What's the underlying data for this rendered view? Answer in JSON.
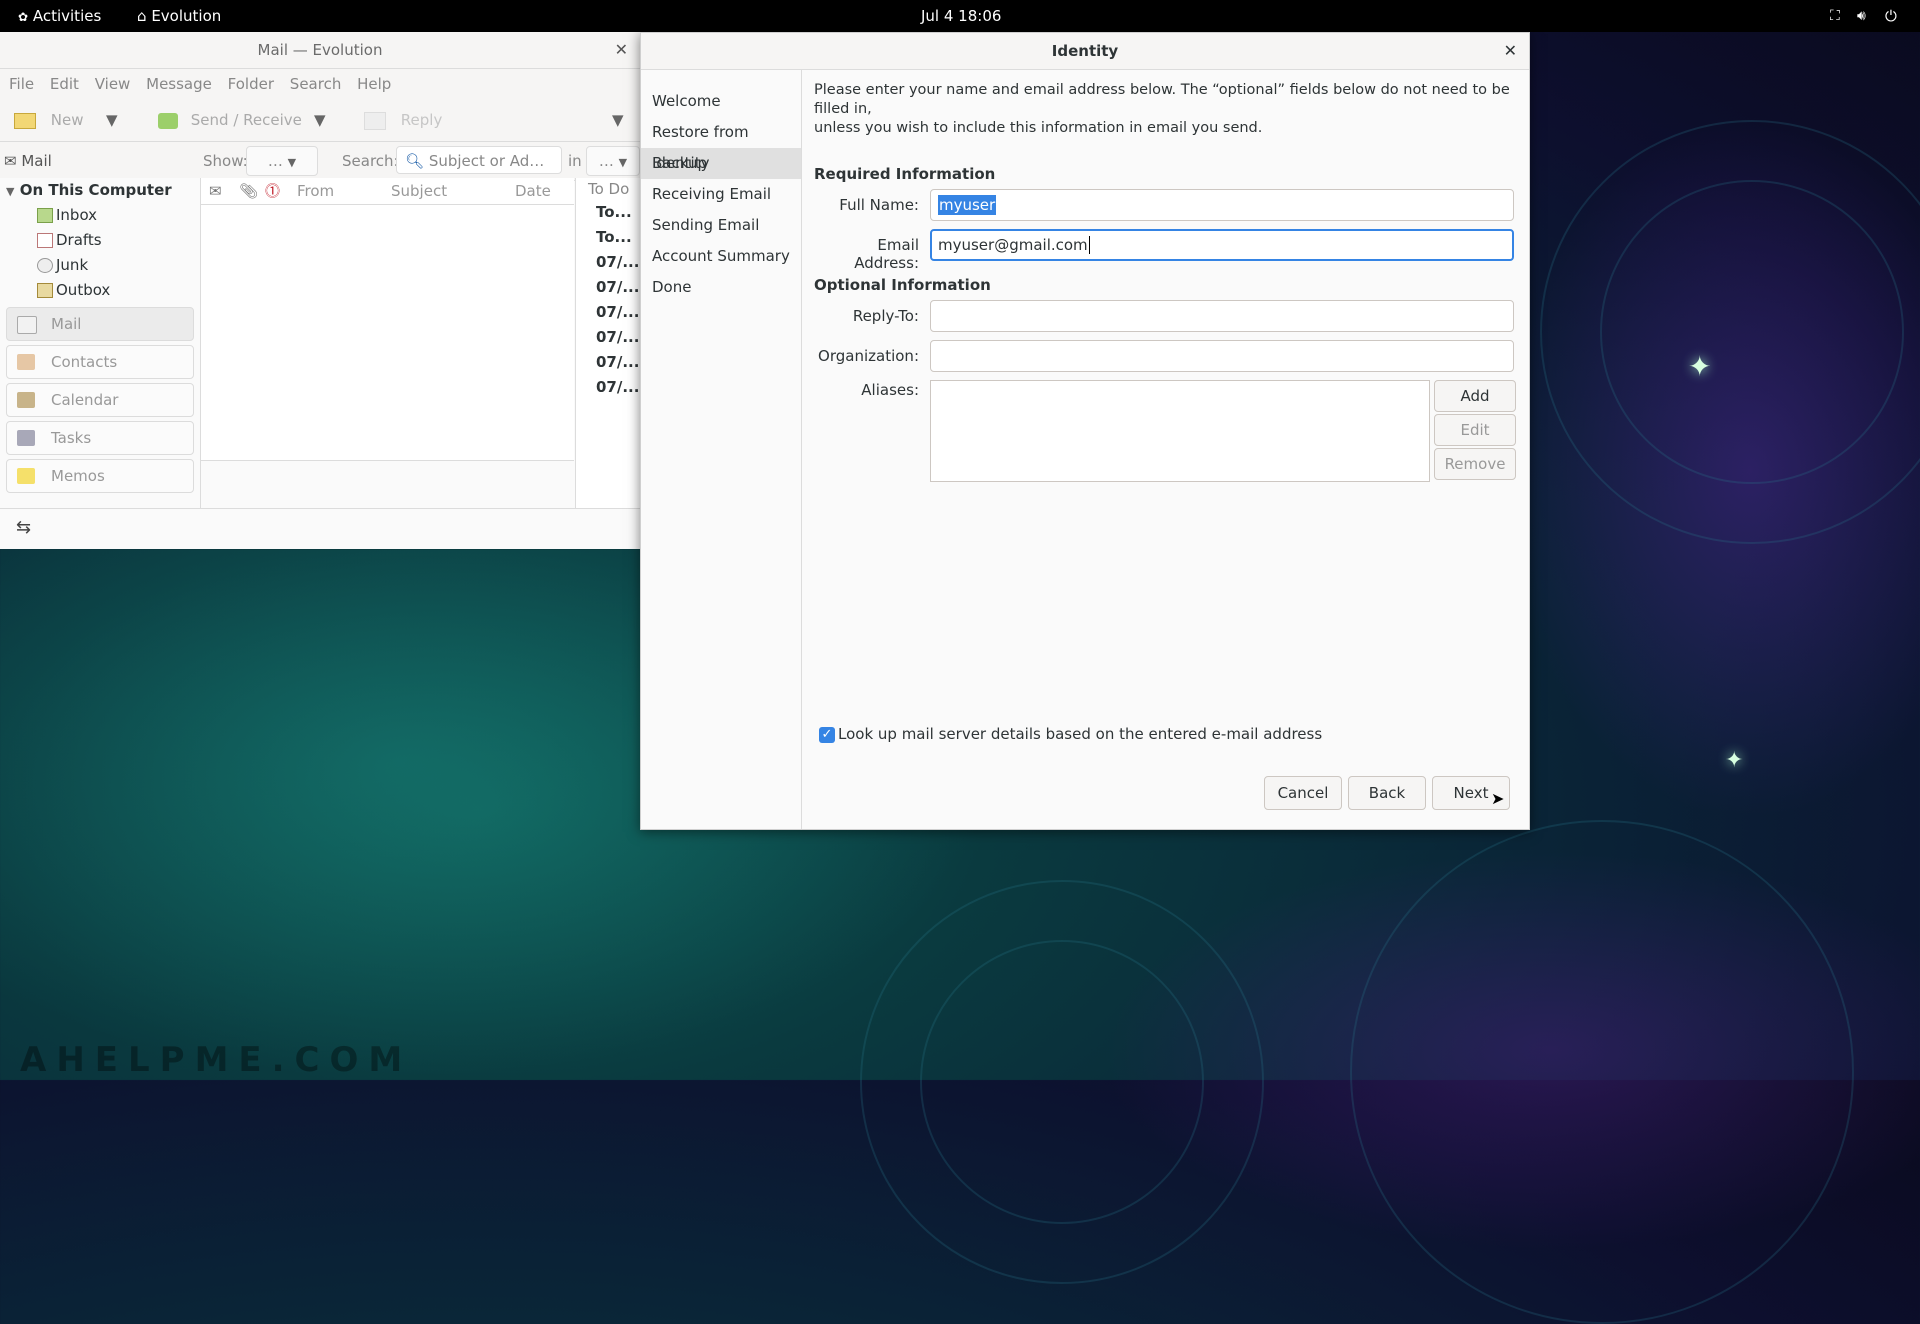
{
  "topbar": {
    "activities": "Activities",
    "app_name": "Evolution",
    "clock": "Jul 4  18:06"
  },
  "main_window": {
    "title": "Mail — Evolution",
    "menu": [
      "File",
      "Edit",
      "View",
      "Message",
      "Folder",
      "Search",
      "Help"
    ],
    "toolbar": {
      "new": "New",
      "send_receive": "Send / Receive",
      "reply": "Reply"
    },
    "searchbar": {
      "mail_label": "Mail",
      "show_label": "Show:",
      "show_value": "…",
      "search_label": "Search:",
      "search_placeholder": "Subject or Ad…",
      "in_label": "in",
      "in_value": "…"
    },
    "folders": {
      "root": "On This Computer",
      "items": [
        "Inbox",
        "Drafts",
        "Junk",
        "Outbox"
      ]
    },
    "switcher": [
      "Mail",
      "Contacts",
      "Calendar",
      "Tasks",
      "Memos"
    ],
    "columns": {
      "from": "From",
      "subject": "Subject",
      "date": "Date"
    },
    "todo": {
      "header": "To Do",
      "rows": [
        "To...",
        "To...",
        "07/...",
        "07/...",
        "07/...",
        "07/...",
        "07/...",
        "07/..."
      ]
    }
  },
  "dialog": {
    "title": "Identity",
    "steps": [
      "Welcome",
      "Restore from Backup",
      "Identity",
      "Receiving Email",
      "Sending Email",
      "Account Summary",
      "Done"
    ],
    "active_step": "Identity",
    "intro_line1": "Please enter your name and email address below. The “optional” fields below do not need to be filled in,",
    "intro_line2": "unless you wish to include this information in email you send.",
    "required_heading": "Required Information",
    "full_name_label": "Full Name:",
    "full_name_value": "myuser",
    "email_label": "Email Address:",
    "email_value": "myuser@gmail.com",
    "optional_heading": "Optional Information",
    "reply_to_label": "Reply-To:",
    "reply_to_value": "",
    "organization_label": "Organization:",
    "organization_value": "",
    "aliases_label": "Aliases:",
    "alias_buttons": {
      "add": "Add",
      "edit": "Edit",
      "remove": "Remove"
    },
    "lookup_checkbox_label": "Look up mail server details based on the entered e-mail address",
    "lookup_checked": true,
    "buttons": {
      "cancel": "Cancel",
      "back": "Back",
      "next": "Next"
    }
  },
  "watermark": "AHELPME.COM",
  "colors": {
    "accent": "#3584e4",
    "topbar": "#000000",
    "window_bg": "#fafafa"
  }
}
